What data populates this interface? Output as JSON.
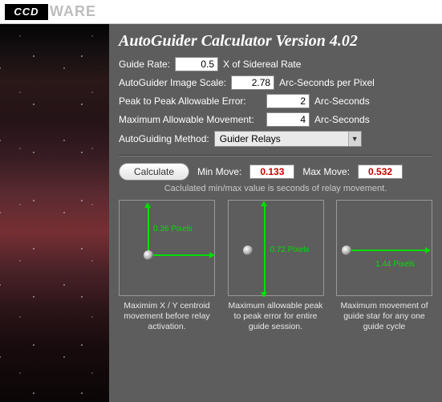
{
  "logo": {
    "boxed": "CCD",
    "rest": "WARE"
  },
  "title": "AutoGuider Calculator Version 4.02",
  "fields": {
    "guide_rate_label": "Guide Rate:",
    "guide_rate_value": "0.5",
    "guide_rate_suffix": "X of Sidereal Rate",
    "scale_label": "AutoGuider Image Scale:",
    "scale_value": "2.78",
    "scale_suffix": "Arc-Seconds per Pixel",
    "p2p_label": "Peak to Peak Allowable Error:",
    "p2p_value": "2",
    "p2p_suffix": "Arc-Seconds",
    "maxmove_label": "Maximum Allowable Movement:",
    "maxmove_value": "4",
    "maxmove_suffix": "Arc-Seconds",
    "method_label": "AutoGuiding Method:",
    "method_value": "Guider Relays"
  },
  "calc": {
    "button": "Calculate",
    "min_label": "Min Move:",
    "min_value": "0.133",
    "max_label": "Max Move:",
    "max_value": "0.532",
    "note": "Caclulated min/max value is seconds of relay movement."
  },
  "dia": {
    "a_px": "0.36 Pixels",
    "b_px": "0.72 Pixels",
    "c_px": "1.44 Pixels",
    "a_cap": "Maximim X / Y centroid movement before relay activation.",
    "b_cap": "Maximum allowable peak to peak error for entire guide session.",
    "c_cap": "Maximum movement of guide star for any one guide cycle"
  }
}
